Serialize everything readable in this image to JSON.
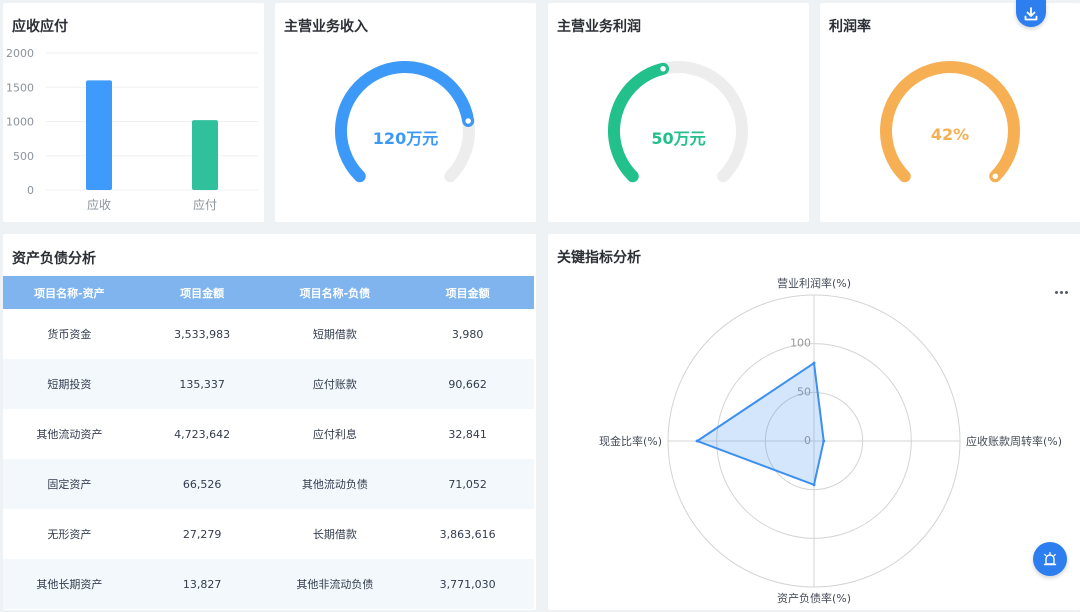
{
  "receivables": {
    "title": "应收应付",
    "chart_data": {
      "type": "bar",
      "categories": [
        "应收",
        "应付"
      ],
      "values": [
        1600,
        1020
      ],
      "ylim": [
        0,
        2000
      ],
      "yticks": [
        "0",
        "500",
        "1000",
        "1500",
        "2000"
      ],
      "colors": [
        "#3e9bfc",
        "#31c09c"
      ]
    }
  },
  "gauges": [
    {
      "title": "主营业务收入",
      "value_label": "120万元",
      "fraction": 0.8,
      "color": "#3d99f7"
    },
    {
      "title": "主营业务利润",
      "value_label": "50万元",
      "fraction": 0.45,
      "color": "#22c08a"
    },
    {
      "title": "利润率",
      "value_label": "42%",
      "fraction": 1.0,
      "color": "#f6b053"
    }
  ],
  "balance": {
    "title": "资产负债分析",
    "headers": [
      "项目名称-资产",
      "项目金额",
      "项目名称-负债",
      "项目金额"
    ],
    "rows": [
      [
        "货币资金",
        "3,533,983",
        "短期借款",
        "3,980"
      ],
      [
        "短期投资",
        "135,337",
        "应付账款",
        "90,662"
      ],
      [
        "其他流动资产",
        "4,723,642",
        "应付利息",
        "32,841"
      ],
      [
        "固定资产",
        "66,526",
        "其他流动负债",
        "71,052"
      ],
      [
        "无形资产",
        "27,279",
        "长期借款",
        "3,863,616"
      ],
      [
        "其他长期资产",
        "13,827",
        "其他非流动负债",
        "3,771,030"
      ]
    ]
  },
  "radar": {
    "title": "关键指标分析",
    "chart_data": {
      "type": "radar",
      "axes": [
        "营业利润率(%)",
        "应收账款周转率(%)",
        "资产负债率(%)",
        "现金比率(%)"
      ],
      "values": [
        80,
        10,
        45,
        120
      ],
      "max": 150,
      "ticks": [
        "0",
        "50",
        "100"
      ],
      "color": "#3d8ff0"
    }
  },
  "icons": {
    "download": "download-icon",
    "more": "more-icon",
    "assistant": "assistant-icon"
  }
}
